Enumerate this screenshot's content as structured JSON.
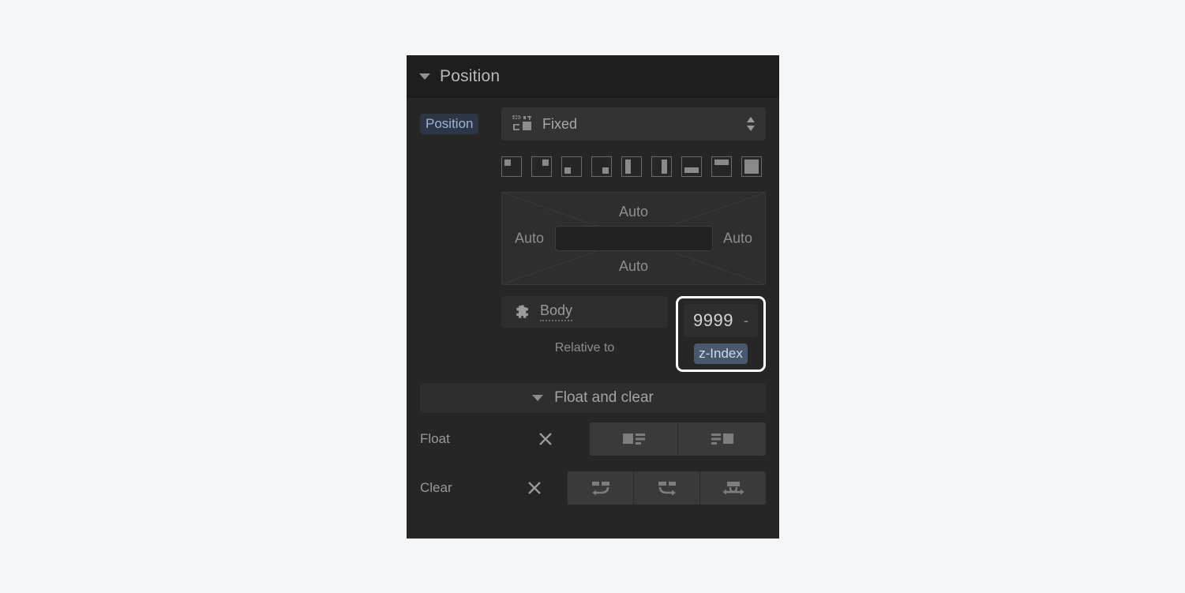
{
  "panel": {
    "section_title": "Position",
    "caret_icon": "caret-down-icon"
  },
  "position_field": {
    "label": "Position",
    "value": "Fixed",
    "icon": "position-layout-icon",
    "stepper_icon": "stepper-updown-icon"
  },
  "presets": [
    {
      "name": "preset-top-left",
      "icon": "square-dot-top-left-icon"
    },
    {
      "name": "preset-top-right",
      "icon": "square-dot-top-right-icon"
    },
    {
      "name": "preset-bottom-left",
      "icon": "square-dot-bottom-left-icon"
    },
    {
      "name": "preset-bottom-right",
      "icon": "square-dot-bottom-right-icon"
    },
    {
      "name": "preset-stretch-left",
      "icon": "bar-left-icon"
    },
    {
      "name": "preset-stretch-right",
      "icon": "bar-right-icon"
    },
    {
      "name": "preset-stretch-bottom",
      "icon": "bar-bottom-icon"
    },
    {
      "name": "preset-stretch-top",
      "icon": "bar-top-icon"
    },
    {
      "name": "preset-fill",
      "icon": "fill-square-icon"
    }
  ],
  "offsets": {
    "top": "Auto",
    "right": "Auto",
    "bottom": "Auto",
    "left": "Auto",
    "center_input_value": ""
  },
  "relative": {
    "value": "Body",
    "icon": "move-target-icon",
    "caption": "Relative to"
  },
  "z_index": {
    "value": "9999",
    "separator": "-",
    "label": "z-Index"
  },
  "float_clear": {
    "title": "Float and clear",
    "caret_icon": "caret-down-icon"
  },
  "float": {
    "label": "Float",
    "options": [
      {
        "name": "float-none",
        "icon": "x-icon",
        "active": true
      },
      {
        "name": "float-left",
        "icon": "float-left-icon",
        "active": false
      },
      {
        "name": "float-right",
        "icon": "float-right-icon",
        "active": false
      }
    ]
  },
  "clear": {
    "label": "Clear",
    "options": [
      {
        "name": "clear-none",
        "icon": "x-icon",
        "active": true
      },
      {
        "name": "clear-left",
        "icon": "clear-left-icon",
        "active": false
      },
      {
        "name": "clear-right",
        "icon": "clear-right-icon",
        "active": false
      },
      {
        "name": "clear-both",
        "icon": "clear-both-icon",
        "active": false
      }
    ]
  },
  "colors": {
    "page_bg": "#f5f6f8",
    "panel_bg": "#262626",
    "header_bg": "#1e1e1e",
    "field_bg": "#333333",
    "label_highlight_bg": "#2c3645",
    "label_highlight_text": "#9db4d8",
    "zindex_pill_bg": "#4a586e",
    "zindex_pill_text": "#cdd9ea",
    "focus_ring": "#ffffff",
    "text_muted": "#9a9a9a"
  }
}
